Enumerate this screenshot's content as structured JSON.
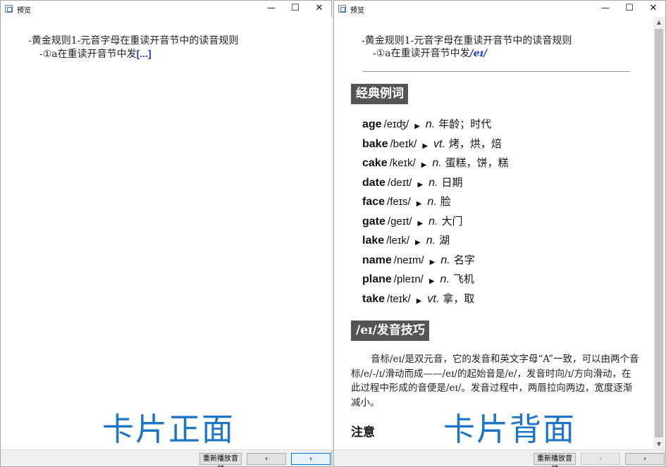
{
  "windows": {
    "left": {
      "title": "预览",
      "front": {
        "line1": "-黄金规则1-元音字母在重读开音节中的读音规则",
        "line2_prefix": "-①a在重读开音节中发",
        "cloze": "[...]"
      }
    },
    "right": {
      "title": "预览",
      "back": {
        "line1": "-黄金规则1-元音字母在重读开音节中的读音规则",
        "line2_prefix": "-①a在重读开音节中发",
        "answer": "/eɪ/"
      },
      "examples_heading": "经典例词",
      "words": [
        {
          "word": "age",
          "ipa": "/eɪʤ/",
          "pos": "n.",
          "def": "年龄；时代"
        },
        {
          "word": "bake",
          "ipa": "/beɪk/",
          "pos": "vt.",
          "def": "烤，烘，焙"
        },
        {
          "word": "cake",
          "ipa": "/keɪk/",
          "pos": "n.",
          "def": "蛋糕，饼，糕"
        },
        {
          "word": "date",
          "ipa": "/deɪt/",
          "pos": "n.",
          "def": "日期"
        },
        {
          "word": "face",
          "ipa": "/feɪs/",
          "pos": "n.",
          "def": "脸"
        },
        {
          "word": "gate",
          "ipa": "/geɪt/",
          "pos": "n.",
          "def": "大门"
        },
        {
          "word": "lake",
          "ipa": "/leɪk/",
          "pos": "n.",
          "def": "湖"
        },
        {
          "word": "name",
          "ipa": "/neɪm/",
          "pos": "n.",
          "def": "名字"
        },
        {
          "word": "plane",
          "ipa": "/pleɪn/",
          "pos": "n.",
          "def": "飞机"
        },
        {
          "word": "take",
          "ipa": "/teɪk/",
          "pos": "vt.",
          "def": "拿，取"
        }
      ],
      "tips_heading": "/eɪ/发音技巧",
      "tips_body": "音标/eɪ/是双元音，它的发音和英文字母“A”一致，可以由两个音标/e/-/ɪ/滑动而成——/eɪ/的起始音是/e/，发音时向/ɪ/方向滑动，在此过程中形成的音便是/eɪ/。发音过程中，两唇拉向两边，宽度逐渐减小。",
      "note_heading": "注意"
    }
  },
  "captions": {
    "front": "卡片正面",
    "back": "卡片背面"
  },
  "window_controls": {
    "minimize": "—",
    "maximize": "☐",
    "close": "✕"
  },
  "bottombar": {
    "replay_label": "重新播放音频",
    "prev_label": "‹",
    "next_label": "›"
  },
  "play_glyph": "▶",
  "colors": {
    "caption": "#1d75c7",
    "cloze": "#1a3cc8",
    "section_bg": "#555555"
  }
}
